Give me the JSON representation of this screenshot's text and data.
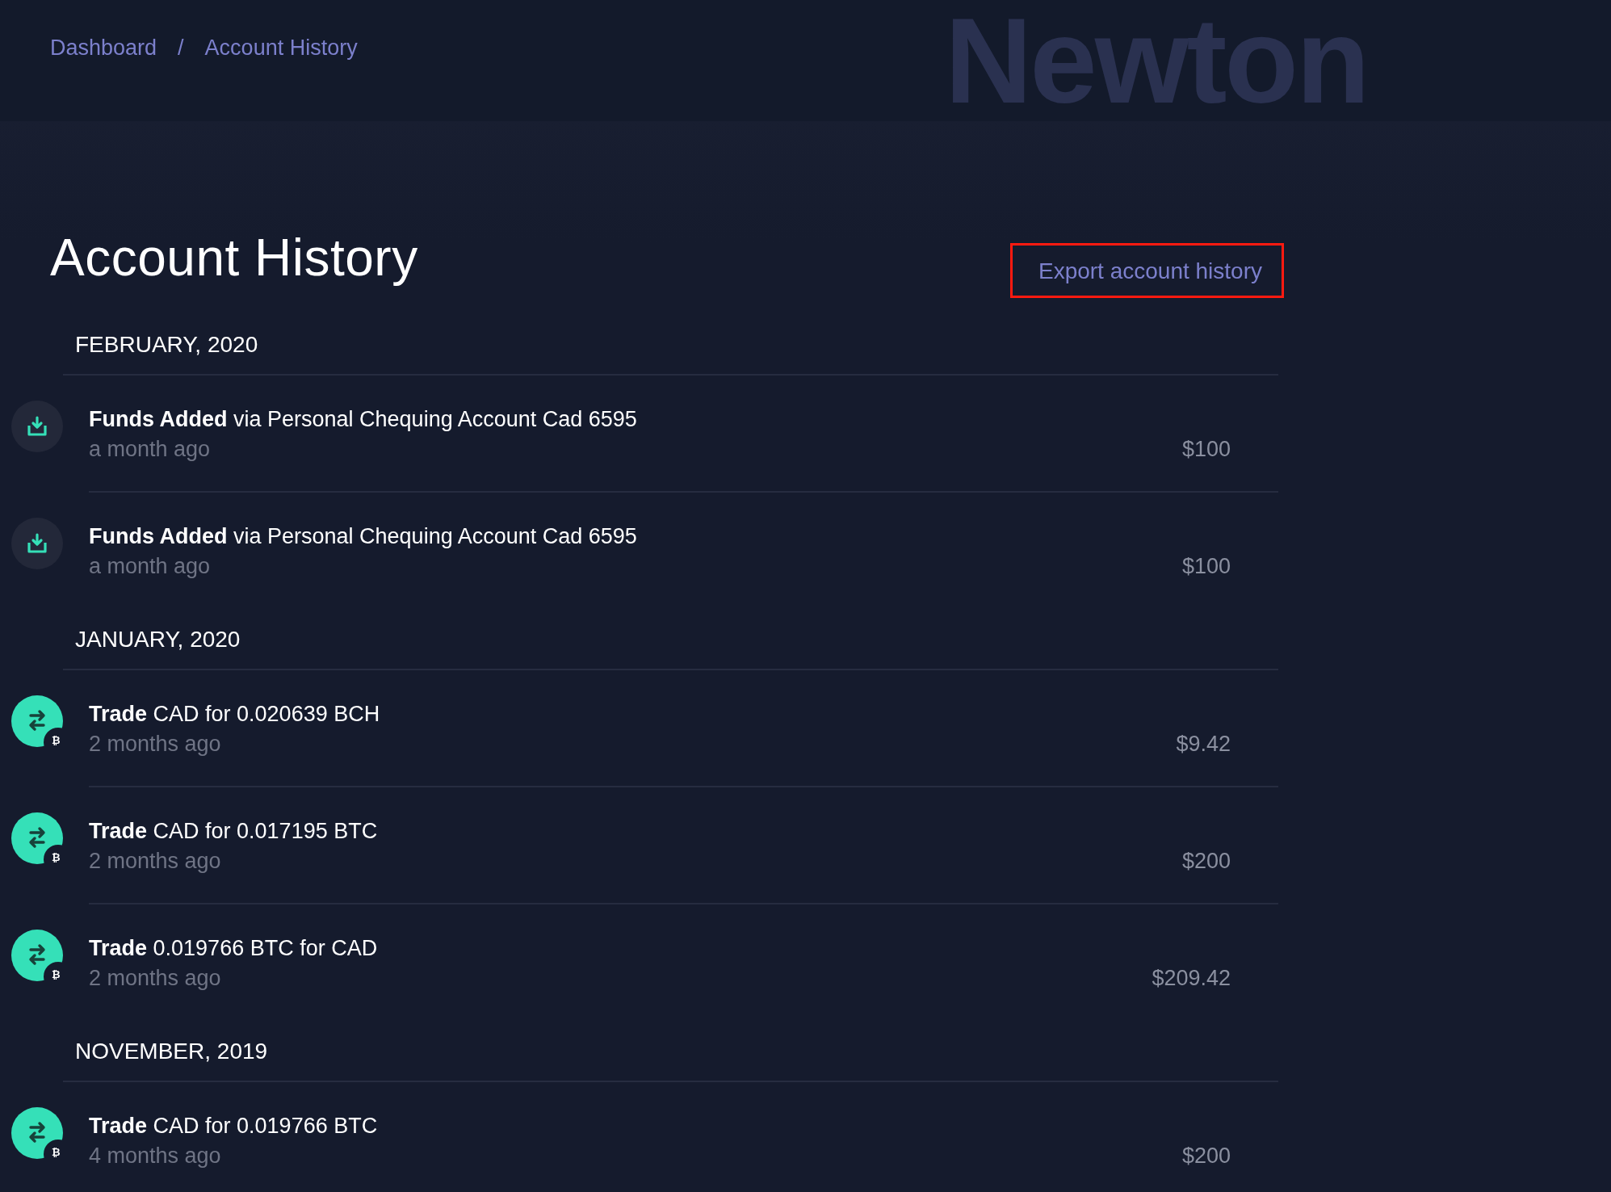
{
  "brand_mark": "Newton",
  "breadcrumb": [
    {
      "label": "Dashboard"
    },
    {
      "label": "Account History"
    }
  ],
  "breadcrumb_separator": "/",
  "title": "Account History",
  "export_button": {
    "label": "Export account history",
    "highlighted": true
  },
  "months": [
    {
      "heading": "FEBRUARY, 2020",
      "transactions": [
        {
          "kind": "deposit",
          "title": "**Funds Added** via Personal Chequing Account Cad 6595",
          "time": "a month ago",
          "amount": "$100"
        },
        {
          "kind": "deposit",
          "title": "**Funds Added** via Personal Chequing Account Cad 6595",
          "time": "a month ago",
          "amount": "$100"
        }
      ]
    },
    {
      "heading": "JANUARY, 2020",
      "transactions": [
        {
          "kind": "trade",
          "coin_symbol": "₿",
          "title": "**Trade** CAD for 0.020639 BCH",
          "time": "2 months ago",
          "amount": "$9.42"
        },
        {
          "kind": "trade",
          "coin_symbol": "₿",
          "title": "**Trade** CAD for 0.017195 BTC",
          "time": "2 months ago",
          "amount": "$200"
        },
        {
          "kind": "trade",
          "coin_symbol": "₿",
          "title": "**Trade** 0.019766 BTC for CAD",
          "time": "2 months ago",
          "amount": "$209.42"
        }
      ]
    },
    {
      "heading": "NOVEMBER, 2019",
      "transactions": [
        {
          "kind": "trade",
          "coin_symbol": "₿",
          "title": "**Trade** CAD for 0.019766 BTC",
          "time": "4 months ago",
          "amount": "$200"
        }
      ]
    }
  ]
}
